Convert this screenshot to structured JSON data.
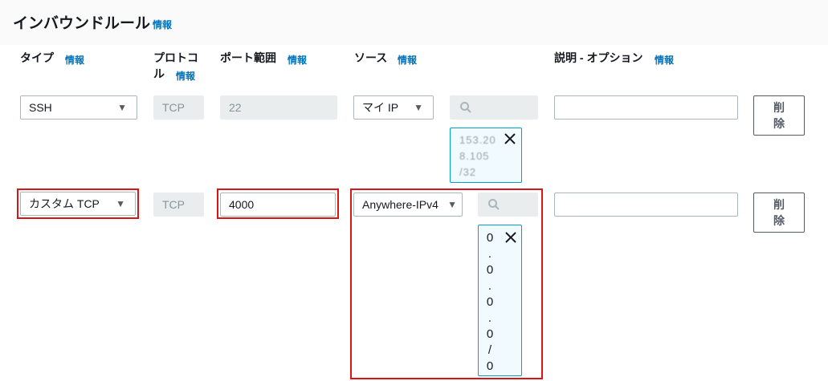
{
  "header": {
    "title": "インバウンドルール",
    "info": "情報"
  },
  "columns": {
    "type": {
      "label": "タイプ",
      "info": "情報"
    },
    "protocol": {
      "label_line1": "プロトコ",
      "label_line2": "ル",
      "info": "情報"
    },
    "port": {
      "label": "ポート範囲",
      "info": "情報"
    },
    "source": {
      "label": "ソース",
      "info": "情報"
    },
    "description": {
      "label": "説明 - オプション",
      "info": "情報"
    }
  },
  "rules": [
    {
      "type": "SSH",
      "protocol": "TCP",
      "port": "22",
      "source": "マイ IP",
      "cidr_chunks": [
        "153.20",
        "8.105",
        "/32"
      ],
      "delete_line1": "削",
      "delete_line2": "除"
    },
    {
      "type": "カスタム TCP",
      "protocol": "TCP",
      "port": "4000",
      "source": "Anywhere-IPv4",
      "cidr_chars": [
        "0",
        ".",
        "0",
        ".",
        "0",
        ".",
        "0",
        "/",
        "0"
      ],
      "delete_line1": "削",
      "delete_line2": "除"
    }
  ],
  "icons": {
    "caret": "caret-down-icon",
    "search": "search-icon",
    "close": "close-icon"
  }
}
